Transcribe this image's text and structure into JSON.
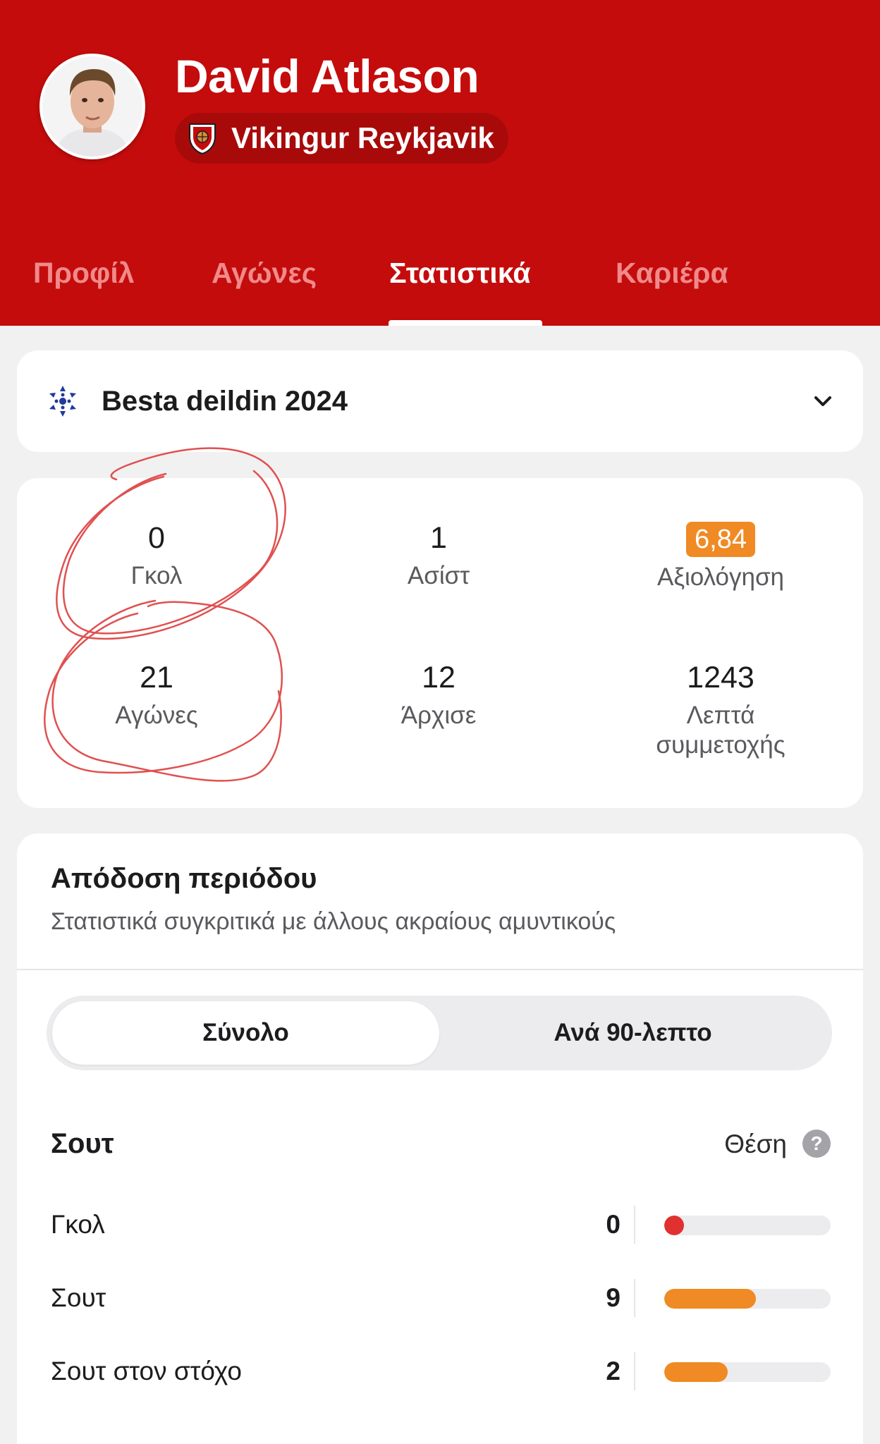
{
  "player": {
    "name": "David Atlason",
    "team": "Vikingur Reykjavik"
  },
  "tabs": [
    {
      "label": "Προφίλ"
    },
    {
      "label": "Αγώνες"
    },
    {
      "label": "Στατιστικά"
    },
    {
      "label": "Καριέρα"
    }
  ],
  "league": {
    "name": "Besta deildin 2024"
  },
  "stats": {
    "goals": {
      "value": "0",
      "label": "Γκολ"
    },
    "assists": {
      "value": "1",
      "label": "Ασίστ"
    },
    "rating": {
      "value": "6,84",
      "label": "Αξιολόγηση"
    },
    "matches": {
      "value": "21",
      "label": "Αγώνες"
    },
    "starts": {
      "value": "12",
      "label": "Άρχισε"
    },
    "minutes": {
      "value": "1243",
      "label": "Λεπτά συμμετοχής"
    }
  },
  "performance": {
    "title": "Απόδοση περιόδου",
    "subtitle": "Στατιστικά συγκριτικά με άλλους ακραίους αμυντικούς",
    "toggle_total": "Σύνολο",
    "toggle_per90": "Ανά 90-λεπτο",
    "section": "Σουτ",
    "position_label": "Θέση",
    "help": "?",
    "rows": [
      {
        "label": "Γκολ",
        "value": "0",
        "percentile": 0
      },
      {
        "label": "Σουτ",
        "value": "9",
        "percentile": 0.55
      },
      {
        "label": "Σουτ στον στόχο",
        "value": "2",
        "percentile": 0.38
      }
    ]
  },
  "colors": {
    "header": "#c40c0c",
    "accent": "#f08a24",
    "goal_dot": "#e03030",
    "annotation": "#e05050"
  }
}
